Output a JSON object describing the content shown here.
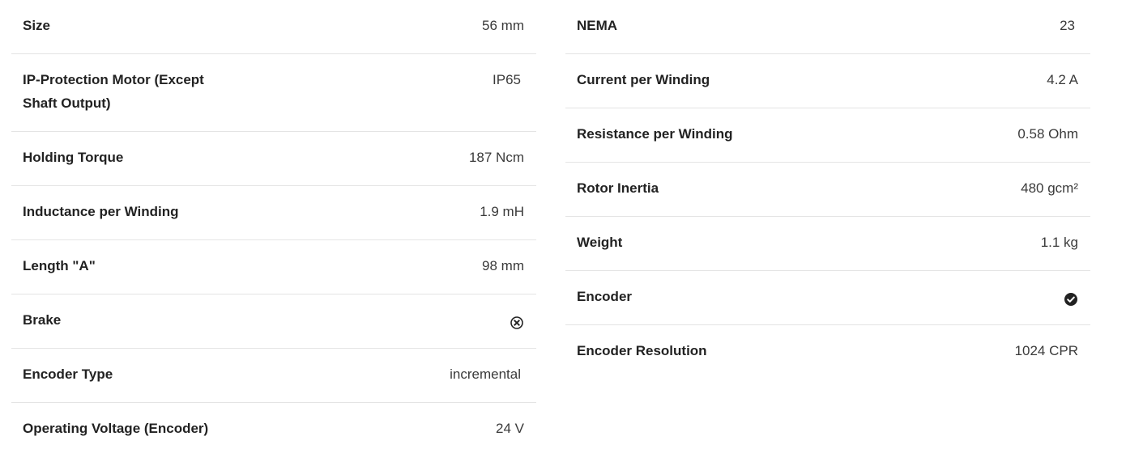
{
  "left_specs": [
    {
      "label": "Size",
      "value": "56 mm"
    },
    {
      "label": "IP-Protection Motor (Except Shaft Output)",
      "value": "IP65"
    },
    {
      "label": "Holding Torque",
      "value": "187 Ncm"
    },
    {
      "label": "Inductance per Winding",
      "value": "1.9 mH"
    },
    {
      "label": "Length \"A\"",
      "value": "98 mm"
    },
    {
      "label": "Brake",
      "icon": "x-circle-icon"
    },
    {
      "label": "Encoder Type",
      "value": "incremental"
    },
    {
      "label": "Operating Voltage (Encoder)",
      "value": "24 V"
    }
  ],
  "right_specs": [
    {
      "label": "NEMA",
      "value": "23"
    },
    {
      "label": "Current per Winding",
      "value": "4.2 A"
    },
    {
      "label": "Resistance per Winding",
      "value": "0.58 Ohm"
    },
    {
      "label": "Rotor Inertia",
      "value": "480 gcm²"
    },
    {
      "label": "Weight",
      "value": "1.1 kg"
    },
    {
      "label": "Encoder",
      "icon": "check-circle-icon"
    },
    {
      "label": "Encoder Resolution",
      "value": "1024 CPR"
    }
  ],
  "colors": {
    "label": "#222222",
    "value": "#3a3a3a",
    "divider": "#e4e4e4",
    "icon": "#222222"
  }
}
